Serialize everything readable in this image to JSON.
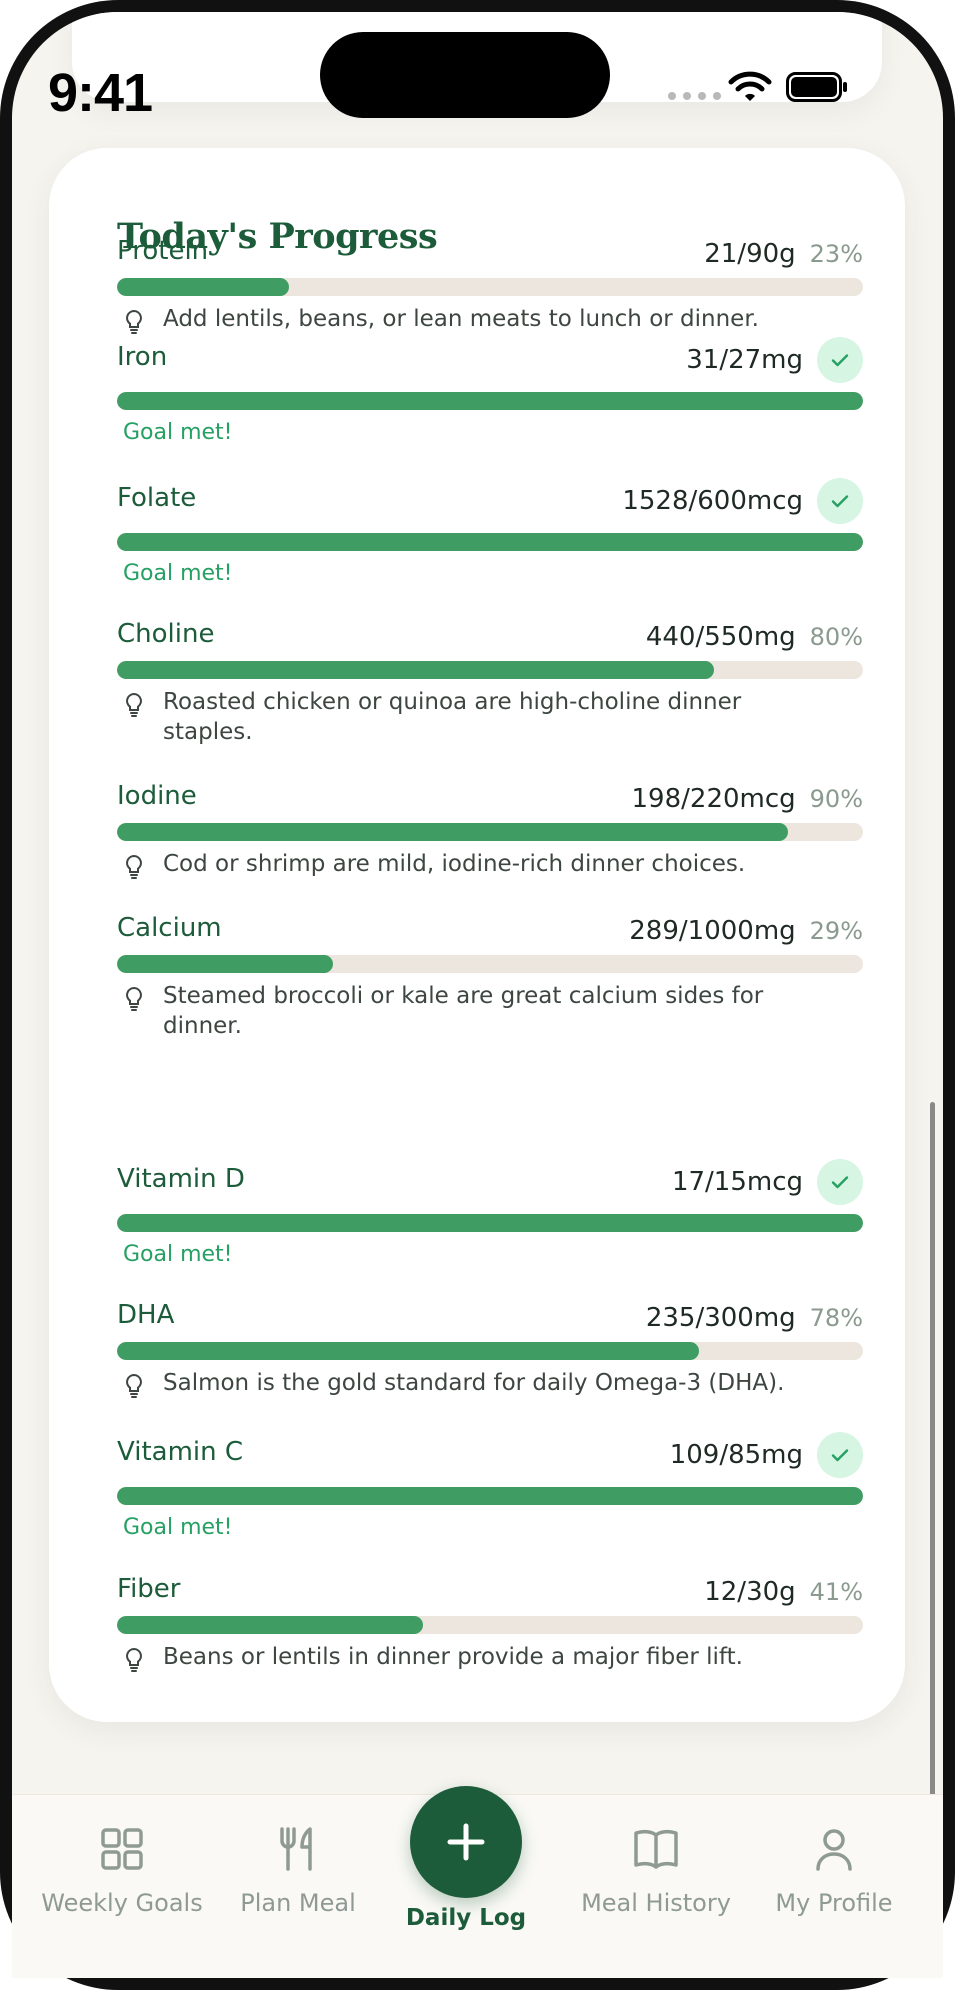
{
  "status_bar": {
    "time": "9:41"
  },
  "card": {
    "title": "Today's Progress",
    "nutrients": [
      {
        "name": "Protein",
        "value": "21/90g",
        "percent": "23%",
        "progress": 0.23,
        "goal_met": false,
        "tip": "Add lentils, beans, or lean meats to lunch or dinner."
      },
      {
        "name": "Iron",
        "value": "31/27mg",
        "percent": "",
        "progress": 1.0,
        "goal_met": true,
        "goal_text": "Goal met!"
      },
      {
        "name": "Folate",
        "value": "1528/600mcg",
        "percent": "",
        "progress": 1.0,
        "goal_met": true,
        "goal_text": "Goal met!"
      },
      {
        "name": "Choline",
        "value": "440/550mg",
        "percent": "80%",
        "progress": 0.8,
        "goal_met": false,
        "tip": "Roasted chicken or quinoa are high-choline dinner staples."
      },
      {
        "name": "Iodine",
        "value": "198/220mcg",
        "percent": "90%",
        "progress": 0.9,
        "goal_met": false,
        "tip": "Cod or shrimp are mild, iodine-rich dinner choices."
      },
      {
        "name": "Calcium",
        "value": "289/1000mg",
        "percent": "29%",
        "progress": 0.29,
        "goal_met": false,
        "tip": "Steamed broccoli or kale are great calcium sides for dinner."
      },
      {
        "name": "Vitamin D",
        "value": "17/15mcg",
        "percent": "",
        "progress": 1.0,
        "goal_met": true,
        "goal_text": "Goal met!"
      },
      {
        "name": "DHA",
        "value": "235/300mg",
        "percent": "78%",
        "progress": 0.78,
        "goal_met": false,
        "tip": "Salmon is the gold standard for daily Omega-3 (DHA)."
      },
      {
        "name": "Vitamin C",
        "value": "109/85mg",
        "percent": "",
        "progress": 1.0,
        "goal_met": true,
        "goal_text": "Goal met!"
      },
      {
        "name": "Fiber",
        "value": "12/30g",
        "percent": "41%",
        "progress": 0.41,
        "goal_met": false,
        "tip": "Beans or lentils in dinner provide a major fiber lift."
      }
    ]
  },
  "tabbar": {
    "tabs": [
      {
        "label": "Weekly Goals",
        "icon": "grid-icon"
      },
      {
        "label": "Plan Meal",
        "icon": "fork-knife-icon"
      },
      {
        "label": "Daily Log",
        "icon": "plus-icon",
        "active": true
      },
      {
        "label": "Meal History",
        "icon": "book-icon"
      },
      {
        "label": "My Profile",
        "icon": "person-icon"
      }
    ]
  },
  "colors": {
    "primary": "#1d5c3a",
    "bar_fill": "#3f9d63",
    "bar_track": "#ece6de",
    "goal_met": "#26a063",
    "badge_bg": "#d6f5e3",
    "background": "#f6f4ef"
  }
}
